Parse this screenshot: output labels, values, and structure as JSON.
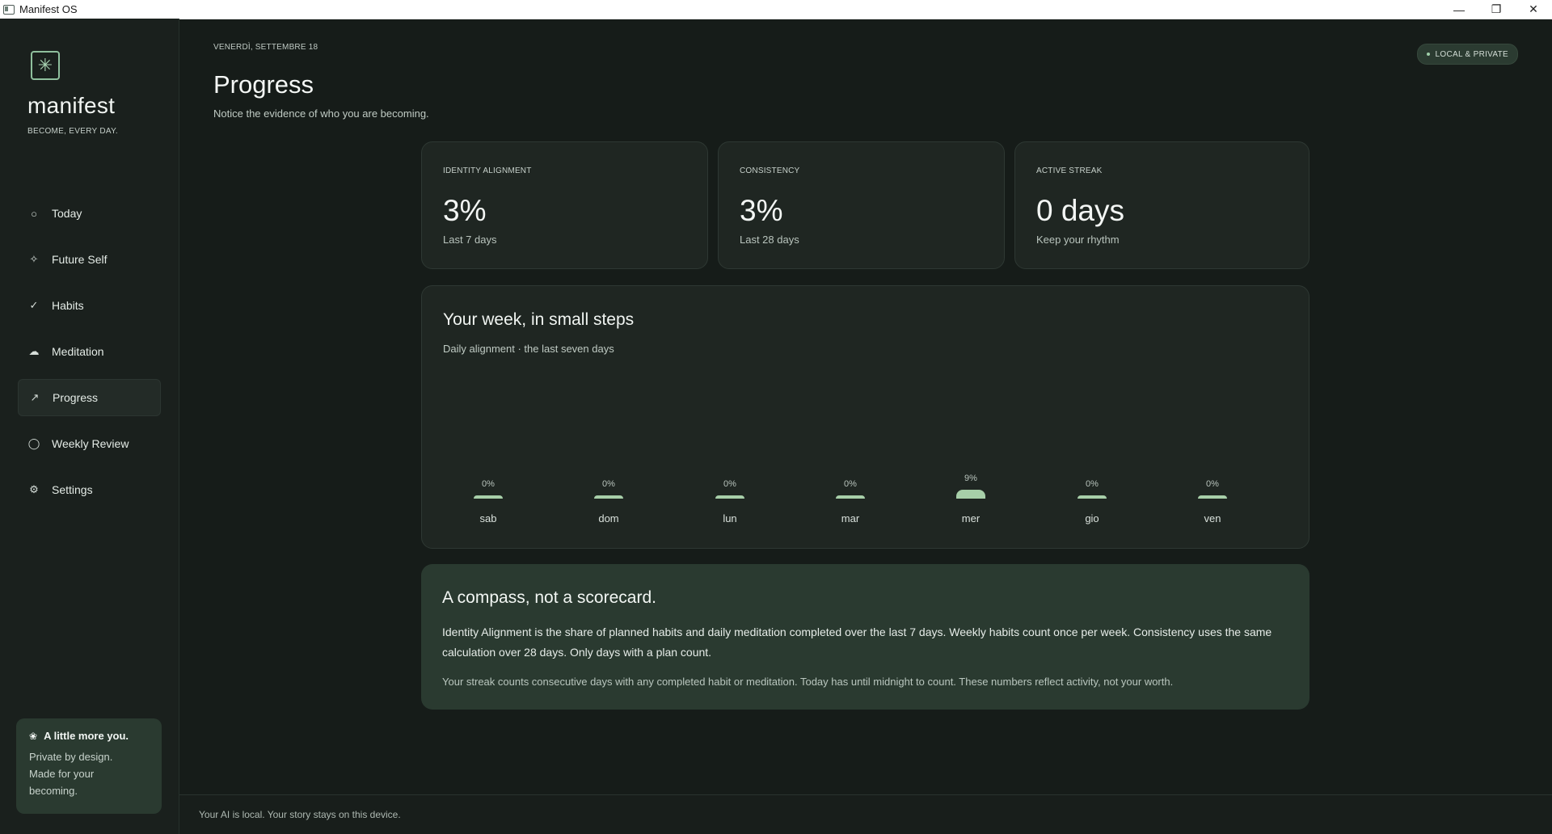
{
  "window": {
    "title": "Manifest OS"
  },
  "sidebar": {
    "brand": "manifest",
    "tagline": "BECOME, EVERY DAY.",
    "items": [
      {
        "label": "Today",
        "icon": "circle-icon",
        "glyph": "○",
        "active": false
      },
      {
        "label": "Future Self",
        "icon": "sparkle-icon",
        "glyph": "✧",
        "active": false
      },
      {
        "label": "Habits",
        "icon": "check-icon",
        "glyph": "✓",
        "active": false
      },
      {
        "label": "Meditation",
        "icon": "cloud-icon",
        "glyph": "☁",
        "active": false
      },
      {
        "label": "Progress",
        "icon": "trend-arrow-icon",
        "glyph": "↗",
        "active": true
      },
      {
        "label": "Weekly Review",
        "icon": "refresh-icon",
        "glyph": "◯",
        "active": false
      },
      {
        "label": "Settings",
        "icon": "gear-icon",
        "glyph": "⚙",
        "active": false
      }
    ],
    "card": {
      "title": "A little more you.",
      "body": "Private by design. Made for your becoming."
    }
  },
  "header": {
    "date": "VENERDÌ, SETTEMBRE 18",
    "title": "Progress",
    "subtitle": "Notice the evidence of who you are becoming.",
    "badge": "LOCAL & PRIVATE"
  },
  "stats": [
    {
      "label": "IDENTITY ALIGNMENT",
      "value": "3%",
      "sub": "Last 7 days"
    },
    {
      "label": "CONSISTENCY",
      "value": "3%",
      "sub": "Last 28 days"
    },
    {
      "label": "ACTIVE STREAK",
      "value": "0 days",
      "sub": "Keep your rhythm"
    }
  ],
  "week": {
    "title": "Your week, in small steps",
    "subtitle": "Daily alignment · the last seven days"
  },
  "chart_data": {
    "type": "bar",
    "categories": [
      "sab",
      "dom",
      "lun",
      "mar",
      "mer",
      "gio",
      "ven"
    ],
    "values": [
      0,
      0,
      0,
      0,
      9,
      0,
      0
    ],
    "labels": [
      "0%",
      "0%",
      "0%",
      "0%",
      "9%",
      "0%",
      "0%"
    ],
    "ylim": [
      0,
      100
    ],
    "color": "#a7cfa9"
  },
  "compass": {
    "title": "A compass, not a scorecard.",
    "p1": "Identity Alignment is the share of planned habits and daily meditation completed over the last 7 days. Weekly habits count once per week. Consistency uses the same calculation over 28 days. Only days with a plan count.",
    "p2": "Your streak counts consecutive days with any completed habit or meditation. Today has until midnight to count. These numbers reflect activity, not your worth."
  },
  "footer": "Your AI is local. Your story stays on this device.",
  "colors": {
    "accent": "#a7cfa9",
    "background": "#161c19",
    "card": "#1f2622",
    "card_highlight": "#2a3a30"
  }
}
